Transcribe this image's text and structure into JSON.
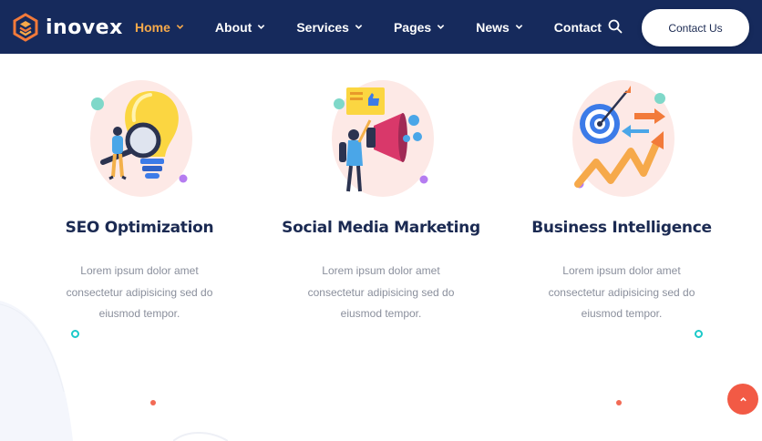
{
  "brand": {
    "name": "inovex"
  },
  "nav": {
    "items": [
      {
        "label": "Home",
        "has_dropdown": true,
        "active": true
      },
      {
        "label": "About",
        "has_dropdown": true,
        "active": false
      },
      {
        "label": "Services",
        "has_dropdown": true,
        "active": false
      },
      {
        "label": "Pages",
        "has_dropdown": true,
        "active": false
      },
      {
        "label": "News",
        "has_dropdown": true,
        "active": false
      },
      {
        "label": "Contact",
        "has_dropdown": false,
        "active": false
      }
    ],
    "contact_button": "Contact Us"
  },
  "services": [
    {
      "title": "SEO Optimization",
      "desc": [
        "Lorem ipsum dolor amet",
        "consectetur adipisicing sed do",
        "eiusmod tempor."
      ],
      "icon": "lightbulb-magnifier-illustration"
    },
    {
      "title": "Social Media Marketing",
      "desc": [
        "Lorem ipsum dolor amet",
        "consectetur adipisicing sed do",
        "eiusmod tempor."
      ],
      "icon": "megaphone-illustration"
    },
    {
      "title": "Business Intelligence",
      "desc": [
        "Lorem ipsum dolor amet",
        "consectetur adipisicing sed do",
        "eiusmod tempor."
      ],
      "icon": "target-growth-illustration"
    }
  ],
  "colors": {
    "navbar": "#162a5c",
    "active_nav": "#f6a94a",
    "title": "#1b2a52",
    "body_text": "#8a8f9c",
    "accent_teal": "#1cc9c9",
    "accent_red": "#f25a45"
  }
}
